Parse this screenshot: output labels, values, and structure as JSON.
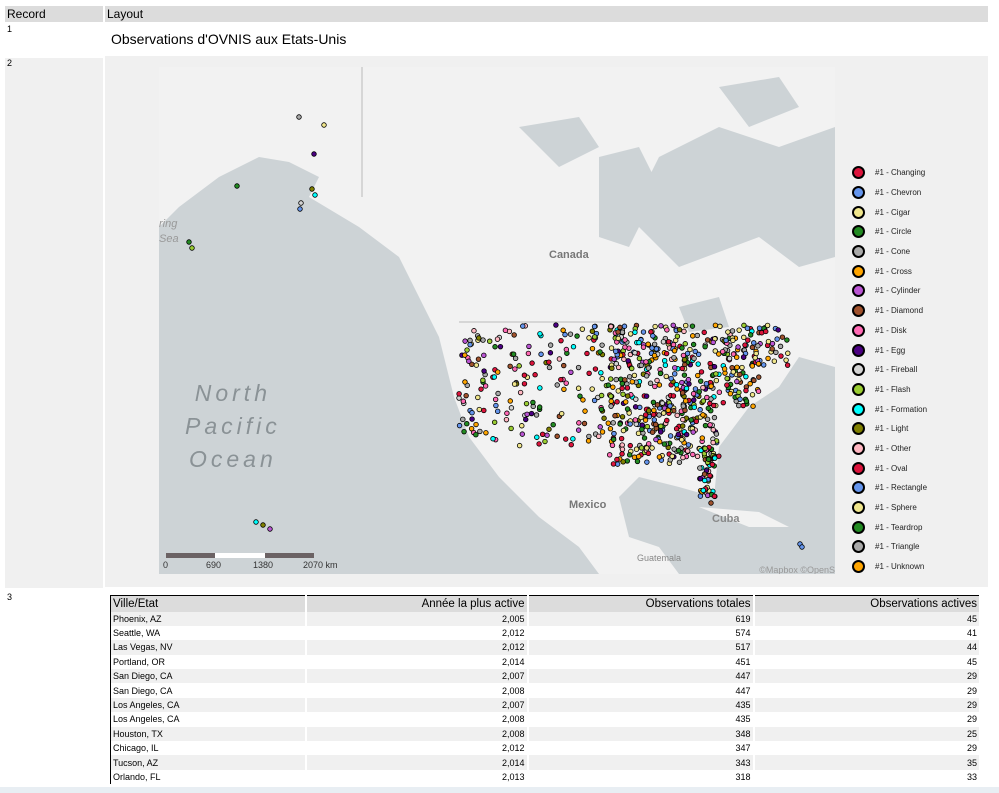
{
  "header": {
    "record": "Record",
    "layout": "Layout"
  },
  "records": [
    "1",
    "2",
    "3"
  ],
  "title": "Observations d'OVNIS aux Etats-Unis",
  "map": {
    "labels": {
      "canada": "Canada",
      "mexico": "Mexico",
      "cuba": "Cuba",
      "guatemala": "Guatemala",
      "ocean1": "North",
      "ocean2": "Pacific",
      "ocean3": "Ocean",
      "bering1": "ring",
      "bering2": "Sea"
    },
    "scale": [
      "0",
      "690",
      "1380",
      "2070 km"
    ],
    "attribution": "©Mapbox ©OpenS",
    "colors": {
      "water": "#cdd3d6",
      "land": "#f2f2f2"
    }
  },
  "legend": [
    {
      "label": "#1 - Changing",
      "color": "#dc143c"
    },
    {
      "label": "#1 - Chevron",
      "color": "#6495ed"
    },
    {
      "label": "#1 - Cigar",
      "color": "#f0e68c"
    },
    {
      "label": "#1 - Circle",
      "color": "#228b22"
    },
    {
      "label": "#1 - Cone",
      "color": "#a9a9a9"
    },
    {
      "label": "#1 - Cross",
      "color": "#ffa500"
    },
    {
      "label": "#1 - Cylinder",
      "color": "#ba55d3"
    },
    {
      "label": "#1 - Diamond",
      "color": "#a0522d"
    },
    {
      "label": "#1 - Disk",
      "color": "#ff69b4"
    },
    {
      "label": "#1 - Egg",
      "color": "#4b0082"
    },
    {
      "label": "#1 - Fireball",
      "color": "#d3d3d3"
    },
    {
      "label": "#1 - Flash",
      "color": "#9acd32"
    },
    {
      "label": "#1 - Formation",
      "color": "#00ffff"
    },
    {
      "label": "#1 - Light",
      "color": "#808000"
    },
    {
      "label": "#1 - Other",
      "color": "#ffb6c1"
    },
    {
      "label": "#1 - Oval",
      "color": "#dc143c"
    },
    {
      "label": "#1 - Rectangle",
      "color": "#6495ed"
    },
    {
      "label": "#1 - Sphere",
      "color": "#f0e68c"
    },
    {
      "label": "#1 - Teardrop",
      "color": "#228b22"
    },
    {
      "label": "#1 - Triangle",
      "color": "#a9a9a9"
    },
    {
      "label": "#1 - Unknown",
      "color": "#ffa500"
    }
  ],
  "table": {
    "columns": [
      "Ville/Etat",
      "Année la plus active",
      "Observations totales",
      "Observations actives"
    ],
    "rows": [
      [
        "Phoenix, AZ",
        "2,005",
        "619",
        "45"
      ],
      [
        "Seattle, WA",
        "2,012",
        "574",
        "41"
      ],
      [
        "Las Vegas, NV",
        "2,012",
        "517",
        "44"
      ],
      [
        "Portland, OR",
        "2,014",
        "451",
        "45"
      ],
      [
        "San Diego, CA",
        "2,007",
        "447",
        "29"
      ],
      [
        "San Diego, CA",
        "2,008",
        "447",
        "29"
      ],
      [
        "Los Angeles, CA",
        "2,007",
        "435",
        "29"
      ],
      [
        "Los Angeles, CA",
        "2,008",
        "435",
        "29"
      ],
      [
        "Houston, TX",
        "2,008",
        "348",
        "25"
      ],
      [
        "Chicago, IL",
        "2,012",
        "347",
        "29"
      ],
      [
        "Tucson, AZ",
        "2,014",
        "343",
        "35"
      ],
      [
        "Orlando, FL",
        "2,013",
        "318",
        "33"
      ]
    ]
  }
}
